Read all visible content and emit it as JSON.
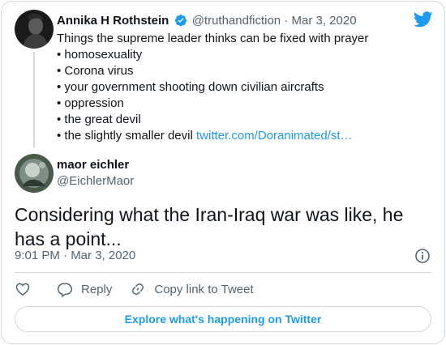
{
  "colors": {
    "accent": "#1d9bf0",
    "text": "#0f1419",
    "muted": "#536471",
    "border": "#cfd9de"
  },
  "icons": [
    "twitter-logo-icon",
    "verified-badge-icon",
    "info-icon",
    "heart-icon",
    "reply-icon",
    "link-icon"
  ],
  "quoted_tweet": {
    "author_name": "Annika H Rothstein",
    "handle": "@truthandfiction",
    "separator": "·",
    "date": "Mar 3, 2020",
    "lines": [
      "Things the supreme leader thinks can be fixed with prayer",
      "• homosexuality",
      "• Corona virus",
      "• your government shooting down civilian aircrafts",
      "• oppression",
      "• the great devil"
    ],
    "last_line_text": "• the slightly smaller devil ",
    "link_text": "twitter.com/Doranimated/st…"
  },
  "tweet": {
    "author_name": "maor eichler",
    "handle": "@EichlerMaor",
    "text": "Considering what the Iran-Iraq war was like, he has a point...",
    "timestamp": "9:01 PM · Mar 3, 2020"
  },
  "actions": {
    "reply_label": "Reply",
    "copy_link_label": "Copy link to Tweet"
  },
  "explore_label": "Explore what's happening on Twitter"
}
